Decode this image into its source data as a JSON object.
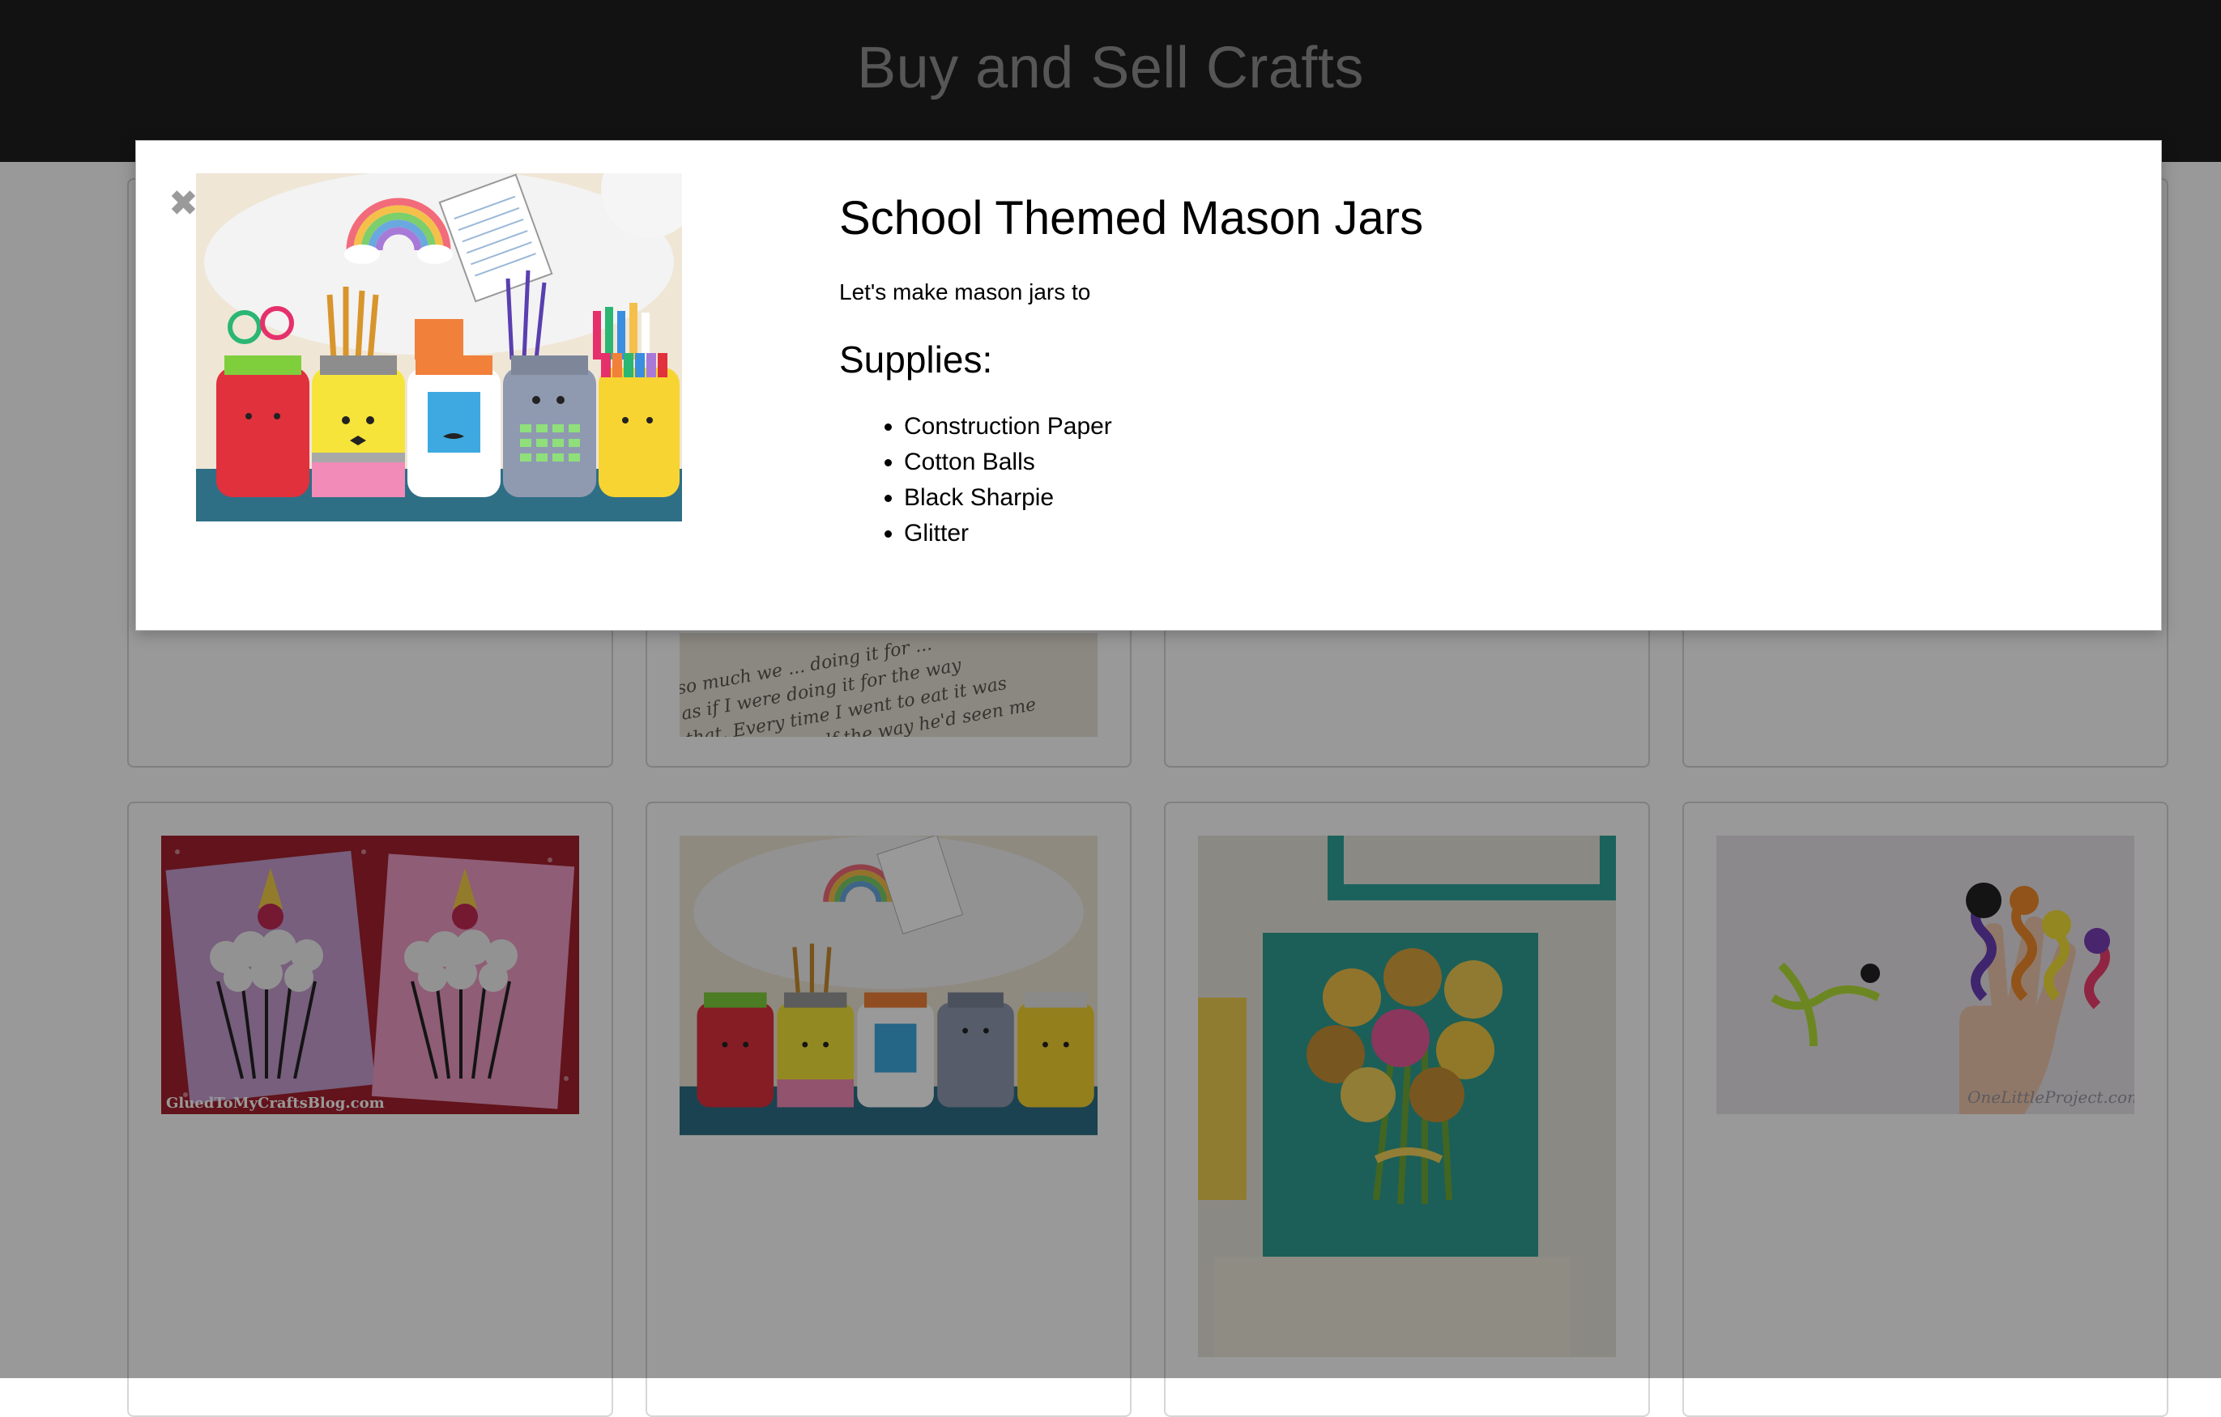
{
  "header": {
    "title": "Buy and Sell Crafts"
  },
  "grid": {
    "cards": [
      {
        "name": "card-top-1"
      },
      {
        "name": "card-top-2"
      },
      {
        "name": "card-top-3"
      },
      {
        "name": "card-top-4"
      },
      {
        "name": "card-unicorn-cupcakes"
      },
      {
        "name": "card-mason-jars"
      },
      {
        "name": "card-egg-carton-flowers"
      },
      {
        "name": "card-pipe-cleaner-bugs"
      }
    ]
  },
  "modal": {
    "close_icon": "close-icon",
    "title": "School Themed Mason Jars",
    "description": "Let's make mason jars to",
    "supplies_heading": "Supplies:",
    "supplies": [
      "Construction Paper",
      "Cotton Balls",
      "Black Sharpie",
      "Glitter"
    ]
  }
}
